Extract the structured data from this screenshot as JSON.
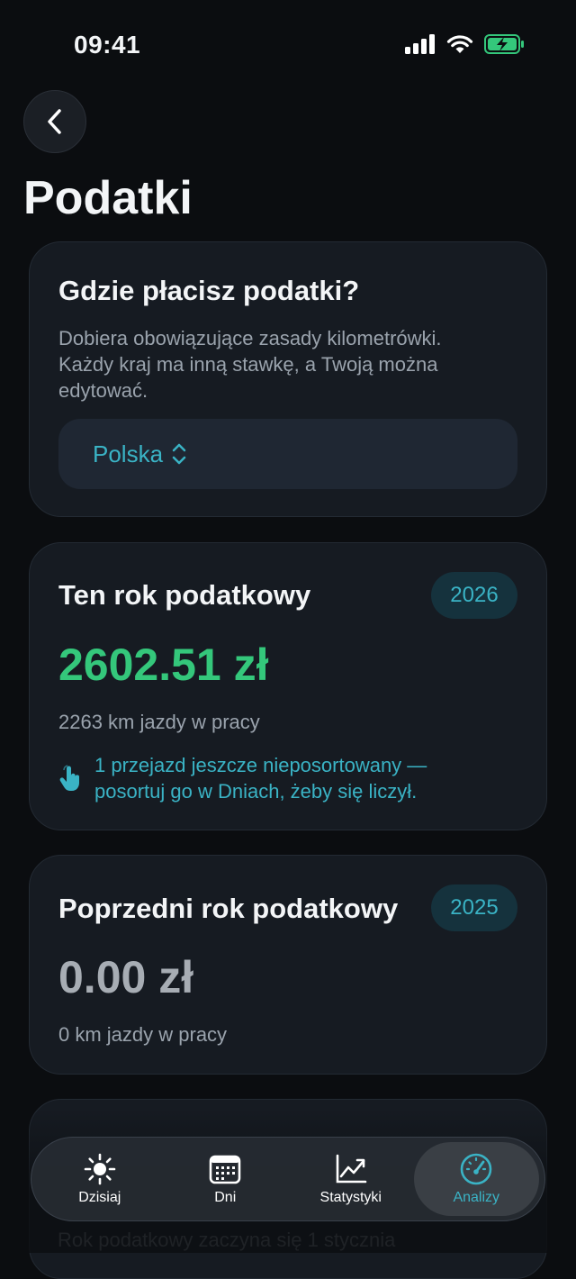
{
  "status_bar": {
    "time": "09:41"
  },
  "header": {
    "title": "Podatki"
  },
  "country_card": {
    "title": "Gdzie płacisz podatki?",
    "description_lines": [
      "Dobiera obowiązujące zasady kilometrówki.",
      "Każdy kraj ma inną stawkę, a Twoją można",
      "edytować."
    ],
    "selected_country": "Polska"
  },
  "this_year_card": {
    "title": "Ten rok podatkowy",
    "year": "2026",
    "amount": "2602.51 zł",
    "km": "2263 km jazdy w pracy",
    "notice_lines": [
      "1 przejazd jeszcze nieposortowany —",
      "posortuj go w Dniach, żeby się liczył."
    ],
    "amount_color": "#34c77b"
  },
  "prev_year_card": {
    "title": "Poprzedni rok podatkowy",
    "year": "2025",
    "amount": "0.00 zł",
    "km": "0 km jazdy w pracy"
  },
  "partial_card": {
    "text": "Rok podatkowy zaczyna się 1 stycznia"
  },
  "tab_bar": {
    "tabs": [
      {
        "label": "Dzisiaj",
        "icon": "sun-icon"
      },
      {
        "label": "Dni",
        "icon": "calendar-icon"
      },
      {
        "label": "Statystyki",
        "icon": "chart-icon"
      },
      {
        "label": "Analizy",
        "icon": "gauge-icon",
        "active": true
      }
    ]
  },
  "colors": {
    "accent": "#3ab3c5",
    "background": "#0b0d10",
    "card": "#161b22",
    "positive": "#34c77b"
  }
}
